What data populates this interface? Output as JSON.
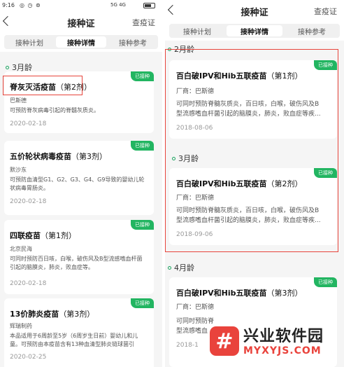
{
  "status_bar": {
    "time": "9:16",
    "icons": "◎ ◷ ⊚",
    "network": "5G 4G"
  },
  "left": {
    "header": {
      "title": "接种证",
      "link": "查疫证"
    },
    "tabs": [
      {
        "label": "接种计划"
      },
      {
        "label": "接种详情"
      },
      {
        "label": "接种参考"
      }
    ],
    "section": "3月龄",
    "cards": [
      {
        "name": "脊灰灭活疫苗",
        "dose": "（第2剂）",
        "badge": "已接种",
        "manufacturer": "巴斯德",
        "desc": "可预防脊灰病毒引起的脊髓灰质炎。",
        "date": "2020-02-18"
      },
      {
        "name": "五价轮状病毒疫苗",
        "dose": "（第3剂）",
        "badge": "已接种",
        "manufacturer": "默沙东",
        "desc": "可预防血清型G1、G2、G3、G4、G9导致的婴幼儿轮状病毒胃肠炎。",
        "date": "2020-02-18"
      },
      {
        "name": "四联疫苗",
        "dose": "（第1剂）",
        "badge": "已接种",
        "manufacturer": "北京民海",
        "desc": "可同时预防百日咳，白喉，破伤风及B型流感嗜血杆菌引起的脑膜炎，肺炎，败血症等。",
        "date": "2020-02-18"
      },
      {
        "name": "13价肺炎疫苗",
        "dose": "（第3剂）",
        "badge": "已接种",
        "manufacturer": "辉瑞制药",
        "desc": "本品适用于6周龄至5岁（6周岁生日前）婴幼儿和儿童。可预防由本疫苗含有13种血清型肺炎链球菌引",
        "date": "2020-02-25"
      }
    ]
  },
  "right": {
    "header": {
      "title": "接种证",
      "link": "查疫证"
    },
    "tabs": [
      {
        "label": "接种计划"
      },
      {
        "label": "接种详情"
      },
      {
        "label": "接种参考"
      }
    ],
    "sections": [
      {
        "title": "2月龄"
      },
      {
        "title": "3月龄"
      },
      {
        "title": "4月龄"
      }
    ],
    "cards": [
      {
        "name": "百白破IPV和Hib五联疫苗",
        "dose": "（第1剂）",
        "badge": "已接种",
        "manufacturer": "厂商：巴斯德",
        "desc_line1": "可同时预防脊髓灰质炎，百日咳，白喉，破伤风及B",
        "desc_line2": "型流感嗜血杆菌引起的脑膜炎，肺炎，败血症等疾...",
        "date": "2018-08-06"
      },
      {
        "name": "百白破IPV和Hib五联疫苗",
        "dose": "（第2剂）",
        "badge": "已接种",
        "manufacturer": "厂商：巴斯德",
        "desc_line1": "可同时预防脊髓灰质炎，百日咳，白喉，破伤风及B",
        "desc_line2": "型流感嗜血杆菌引起的脑膜炎，肺炎，败血症等疾...",
        "date": "2018-09-06"
      },
      {
        "name": "百白破IPV和Hib五联疫苗",
        "dose": "（第3剂）",
        "badge": "已接种",
        "manufacturer": "厂商：巴斯德",
        "desc_line1": "可同时预防脊",
        "desc_line2": "型流感嗜血",
        "date": "2018-1"
      }
    ]
  },
  "watermark": {
    "logo": "#",
    "title": "兴业软件园",
    "url": "MYXYJS.COM"
  },
  "colors": {
    "accent_green": "#22b561",
    "highlight_red": "#e7443b",
    "watermark_red": "#e9433c",
    "background": "#f5f5f5"
  }
}
